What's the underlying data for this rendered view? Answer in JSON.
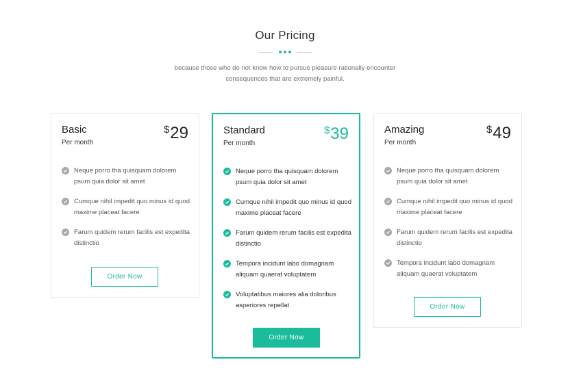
{
  "section": {
    "title": "Our Pricing",
    "subtitle_line1": "because those who do not know how to pursue pleasure rationally encounter",
    "subtitle_line2": "consequences that are extremely painful."
  },
  "colors": {
    "accent": "#1abc9c",
    "check_muted": "#a9a9a9",
    "border": "#e7e7e7"
  },
  "plans": [
    {
      "name": "Basic",
      "period": "Per month",
      "currency": "$",
      "price": "29",
      "button": "Order Now",
      "features": [
        "Neque porro tha quisquam dolorem psum quia dolor sit amet",
        "Cumque nihil impedit quo minus id quod maxime placeat facere",
        "Farum quidem rerum facilis est expedita distinctio"
      ]
    },
    {
      "name": "Standard",
      "period": "Per month",
      "currency": "$",
      "price": "39",
      "button": "Order Now",
      "features": [
        "Neque porro tha quisquam dolorem psum quia dolor sit amet",
        "Cumque nihil impedit quo minus id quod maxime placeat facere",
        "Farum quidem rerum facilis est expedita distinctio",
        "Tempora incidunt labo domagnam aliquam quaerat voluptatem",
        "Voluptatibus maiores alia doloribus asperiores repellat"
      ]
    },
    {
      "name": "Amazing",
      "period": "Per month",
      "currency": "$",
      "price": "49",
      "button": "Order Now",
      "features": [
        "Neque porro tha quisquam dolorem psum quia dolor sit amet",
        "Cumque nihil impedit quo minus id quod maxime placeat facere",
        "Farum quidem rerum facilis est expedita distinctio",
        "Tempora incidunt labo domagnam aliquam quaerat voluptatem"
      ]
    }
  ]
}
